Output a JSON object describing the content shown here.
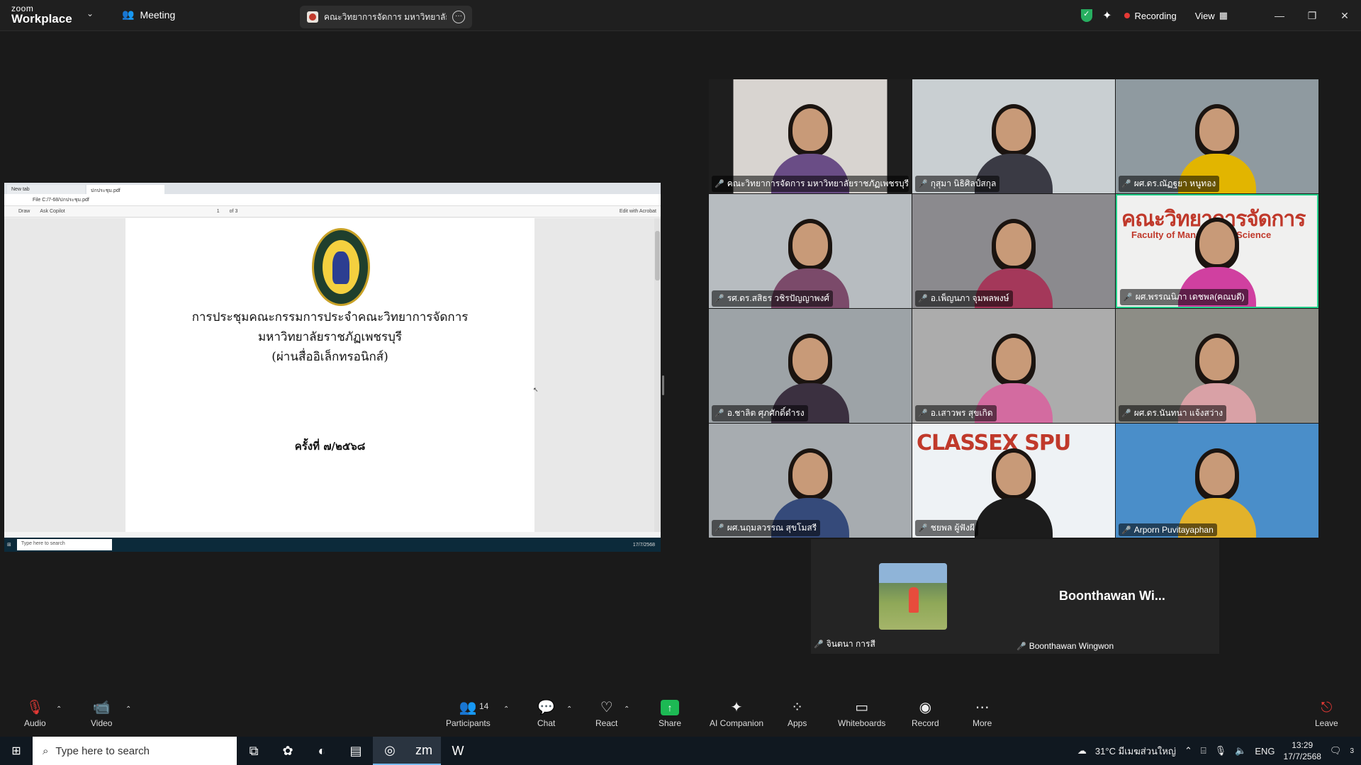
{
  "app": {
    "brand_top": "zoom",
    "brand_main": "Workplace",
    "meeting_label": "Meeting",
    "share_tab_title": "คณะวิทยาการจัดการ มหาวิทยาลัยราชภัฏ",
    "recording_label": "Recording",
    "view_label": "View"
  },
  "shared": {
    "tab1": "New tab",
    "tab2": "ปกประชุม.pdf",
    "address": "File   C:/7-68/ปกประชุม.pdf",
    "tool_draw": "Draw",
    "tool_copilot": "Ask Copilot",
    "page_num": "1",
    "page_total": "of 3",
    "edit_acrobat": "Edit with Acrobat",
    "line1": "การประชุมคณะกรรมการประจำคณะวิทยาการจัดการ",
    "line2": "มหาวิทยาลัยราชภัฏเพชรบุรี",
    "line3": "(ผ่านสื่ออิเล็กทรอนิกส์)",
    "line4": "ครั้งที่ ๗/๒๕๖๘",
    "task_search": "Type here to search",
    "task_right": "17/7/2568"
  },
  "tiles": [
    {
      "name": "คณะวิทยาการจัดการ มหาวิทยาลัยราชภัฏเพชรบุรี",
      "bg": "#d8d4d0",
      "shirt": "#6a4d86"
    },
    {
      "name": "กุสุมา นิธิศิลป์สกุล",
      "bg": "#c9cfd2",
      "shirt": "#3a3a44"
    },
    {
      "name": "ผศ.ดร.ณัฏฐยา หนูทอง",
      "bg": "#8f9aa0",
      "shirt": "#e2b500"
    },
    {
      "name": "รศ.ดร.สสิธร วชิรปัญญาพงศ์",
      "bg": "#b7bcc0",
      "shirt": "#7b4a6a"
    },
    {
      "name": "อ.เพ็ญนภา จุมพลพงษ์",
      "bg": "#8b8a8e",
      "shirt": "#a4385a"
    },
    {
      "name": "ผศ.พรรณนิภา เดชพล(คณบดี)",
      "bg": "#f0f0ef",
      "shirt": "#d040a0",
      "banner": "คณะวิทยาการจัดการ",
      "banner_sub": "Faculty of Management Science"
    },
    {
      "name": "อ.ชาลิต ศุภศักดิ์ดำรง",
      "bg": "#9da3a7",
      "shirt": "#3b3040"
    },
    {
      "name": "อ.เสาวพร สุขเกิด",
      "bg": "#acacac",
      "shirt": "#d36ba0"
    },
    {
      "name": "ผศ.ดร.นันทนา แจ้งสว่าง",
      "bg": "#8d8d86",
      "shirt": "#d9a1a6"
    },
    {
      "name": "ผศ.นฤมลวรรณ สุขโมสรี",
      "bg": "#a7acb0",
      "shirt": "#354a7a"
    },
    {
      "name": "ชยพล ผู้ฟังผี",
      "bg": "#eef2f5",
      "shirt": "#1c1c1c",
      "banner": "CLASSEX SPU"
    },
    {
      "name": "Arporn Puvitayaphan",
      "bg": "#4a8ec9",
      "shirt": "#e2b22b"
    }
  ],
  "bottom": {
    "left_name": "จินตนา การสี",
    "right_big": "Boonthawan Wi...",
    "right_name": "Boonthawan Wingwon"
  },
  "toolbar": {
    "audio": "Audio",
    "video": "Video",
    "participants": "Participants",
    "participants_count": "14",
    "chat": "Chat",
    "react": "React",
    "share": "Share",
    "ai": "AI Companion",
    "apps": "Apps",
    "whiteboards": "Whiteboards",
    "record": "Record",
    "more": "More",
    "leave": "Leave"
  },
  "taskbar": {
    "search": "Type here to search",
    "weather": "31°C  มีเมฆส่วนใหญ่",
    "lang": "ENG",
    "time": "13:29",
    "date": "17/7/2568",
    "notif": "3"
  }
}
